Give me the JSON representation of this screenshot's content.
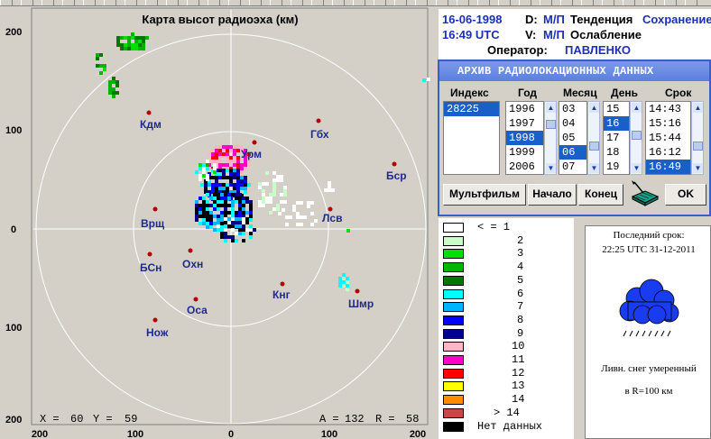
{
  "toolbar": {
    "button_count": 34
  },
  "map": {
    "title": "Карта высот радиоэха (км)",
    "axis_ticks": {
      "left": [
        "200",
        "100",
        "0",
        "100",
        "200"
      ],
      "bottom": [
        "200",
        "100",
        "0",
        "100",
        "200"
      ]
    },
    "cities": [
      {
        "name": "Кдм"
      },
      {
        "name": "Гбх"
      },
      {
        "name": "Урм"
      },
      {
        "name": "Бср"
      },
      {
        "name": "Лсв"
      },
      {
        "name": "Врщ"
      },
      {
        "name": "Охн"
      },
      {
        "name": "БСн"
      },
      {
        "name": "Кнг"
      },
      {
        "name": "Шмр"
      },
      {
        "name": "Оса"
      },
      {
        "name": "Нож"
      }
    ],
    "cursor_readout": {
      "x_label": "X =",
      "x": "60",
      "y_label": "Y =",
      "y": "59",
      "a_label": "A =",
      "a": "132",
      "r_label": "R =",
      "r": "58"
    },
    "colors": {
      "ring": "#ffffff",
      "city_dot": "#b80000",
      "background": "#d4d0c8"
    }
  },
  "info": {
    "date": "16-06-1998",
    "d_label": "D:",
    "d_value": "М/П",
    "trend_label": "Тенденция",
    "trend_value": "Сохранение",
    "time": "16:49  UTC",
    "v_label": "V:",
    "v_value": "М/П",
    "v_text": "Ослабление",
    "operator_label": "Оператор:",
    "operator_name": "ПАВЛЕНКО"
  },
  "archive": {
    "title": "АРХИВ  РАДИОЛОКАЦИОННЫХ ДАННЫХ",
    "columns": {
      "index": {
        "header": "Индекс",
        "items": [
          "28225"
        ],
        "selected": 0
      },
      "year": {
        "header": "Год",
        "items": [
          "1996",
          "1997",
          "1998",
          "1999",
          "2006"
        ],
        "selected": 2
      },
      "month": {
        "header": "Месяц",
        "items": [
          "03",
          "04",
          "05",
          "06",
          "07"
        ],
        "selected": 3
      },
      "day": {
        "header": "День",
        "items": [
          "15",
          "16",
          "17",
          "18",
          "19"
        ],
        "selected": 1
      },
      "term": {
        "header": "Срок",
        "items": [
          "14:43",
          "15:16",
          "15:44",
          "16:12",
          "16:49"
        ],
        "selected": 4
      }
    },
    "buttons": {
      "multfilm": "Мультфильм",
      "start": "Начало",
      "end": "Конец",
      "ok": "OK"
    }
  },
  "legend": {
    "items": [
      {
        "label": "< = 1",
        "color": "#ffffff"
      },
      {
        "label": "2",
        "color": "#c8ffc8"
      },
      {
        "label": "3",
        "color": "#00e000"
      },
      {
        "label": "4",
        "color": "#00b400"
      },
      {
        "label": "5",
        "color": "#007800"
      },
      {
        "label": "6",
        "color": "#00ffff"
      },
      {
        "label": "7",
        "color": "#00b4ff"
      },
      {
        "label": "8",
        "color": "#0000ff"
      },
      {
        "label": "9",
        "color": "#00008c"
      },
      {
        "label": "10",
        "color": "#ffb4c8"
      },
      {
        "label": "11",
        "color": "#ff00c8"
      },
      {
        "label": "12",
        "color": "#ff0000"
      },
      {
        "label": "13",
        "color": "#ffff00"
      },
      {
        "label": "14",
        "color": "#ff8c00"
      },
      {
        "label": "> 14",
        "color": "#c84646"
      },
      {
        "label": "Нет данных",
        "color": "#000000"
      }
    ]
  },
  "weather": {
    "last_term_label": "Последний срок:",
    "last_term_value": "22:25 UTC 31-12-2011",
    "phenomenon": "Ливн. снег умеренный",
    "radius": "в R=100 км",
    "icon": "snow-shower-cloud-icon",
    "cloud_color": "#1a3cf0"
  }
}
